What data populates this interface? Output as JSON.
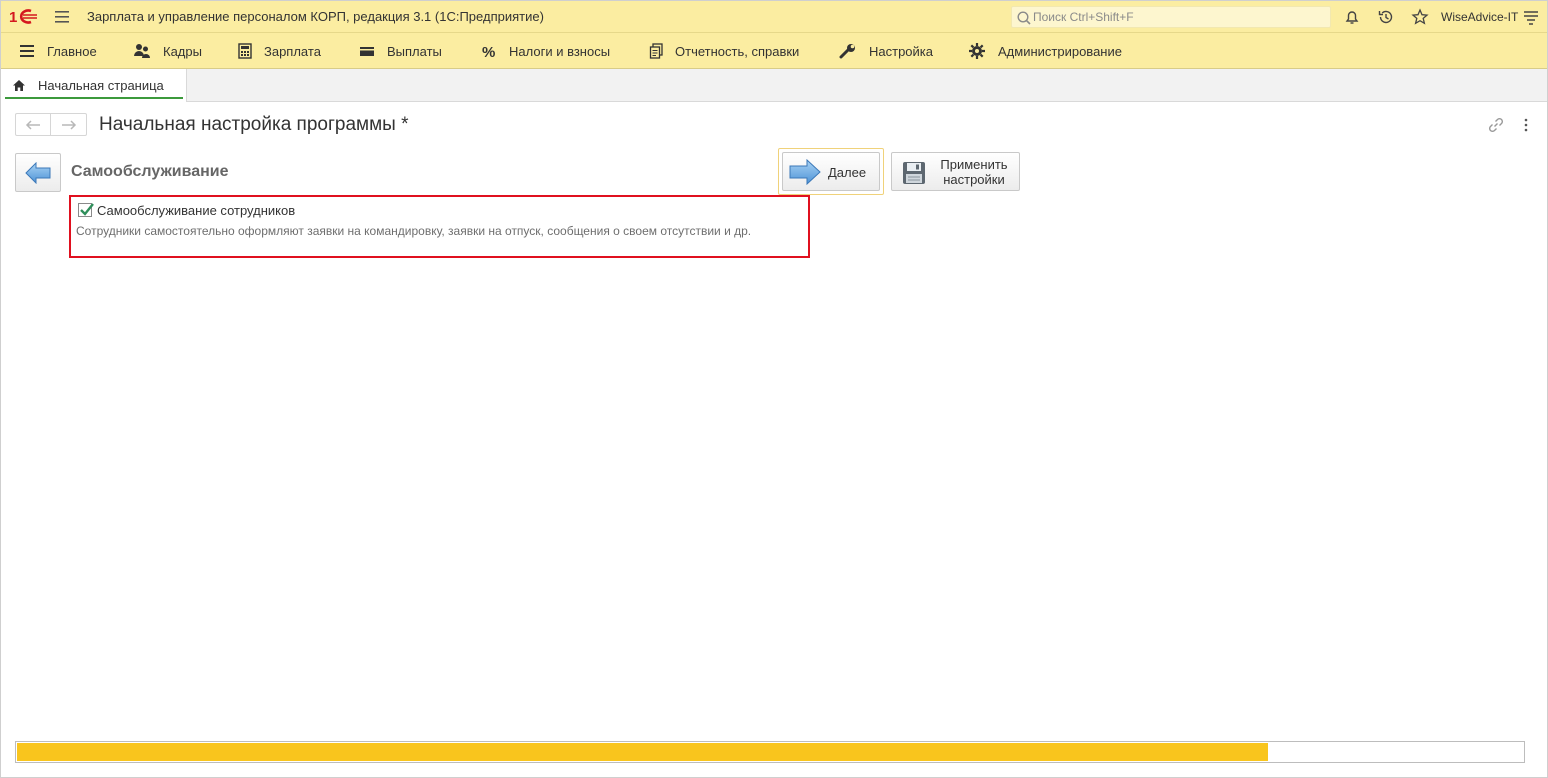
{
  "titlebar": {
    "logo": "1c-logo",
    "title": "Зарплата и управление персоналом КОРП, редакция 3.1  (1С:Предприятие)",
    "search_placeholder": "Поиск Ctrl+Shift+F",
    "user": "WiseAdvice-IT"
  },
  "menu": {
    "items": [
      {
        "label": "Главное",
        "icon": "menu-lines-icon"
      },
      {
        "label": "Кадры",
        "icon": "people-icon"
      },
      {
        "label": "Зарплата",
        "icon": "calculator-icon"
      },
      {
        "label": "Выплаты",
        "icon": "wallet-icon"
      },
      {
        "label": "Налоги и взносы",
        "icon": "percent-icon"
      },
      {
        "label": "Отчетность, справки",
        "icon": "documents-icon"
      },
      {
        "label": "Настройка",
        "icon": "wrench-icon"
      },
      {
        "label": "Администрирование",
        "icon": "gear-icon"
      }
    ]
  },
  "tabs": {
    "home_label": "Начальная страница"
  },
  "form": {
    "title": "Начальная настройка программы *",
    "section_title": "Самообслуживание",
    "next_label": "Далее",
    "apply_label_line1": "Применить",
    "apply_label_line2": "настройки"
  },
  "option": {
    "checked": true,
    "label": "Самообслуживание сотрудников",
    "description": "Сотрудники самостоятельно оформляют заявки на командировку, заявки на отпуск, сообщения о своем отсутствии и др."
  },
  "progress": {
    "fraction": 0.831
  },
  "colors": {
    "accent_yellow": "#fbeda1",
    "progress_fill": "#f9c51d",
    "highlight_border": "#e0101f",
    "check_green": "#2f8f5b"
  }
}
